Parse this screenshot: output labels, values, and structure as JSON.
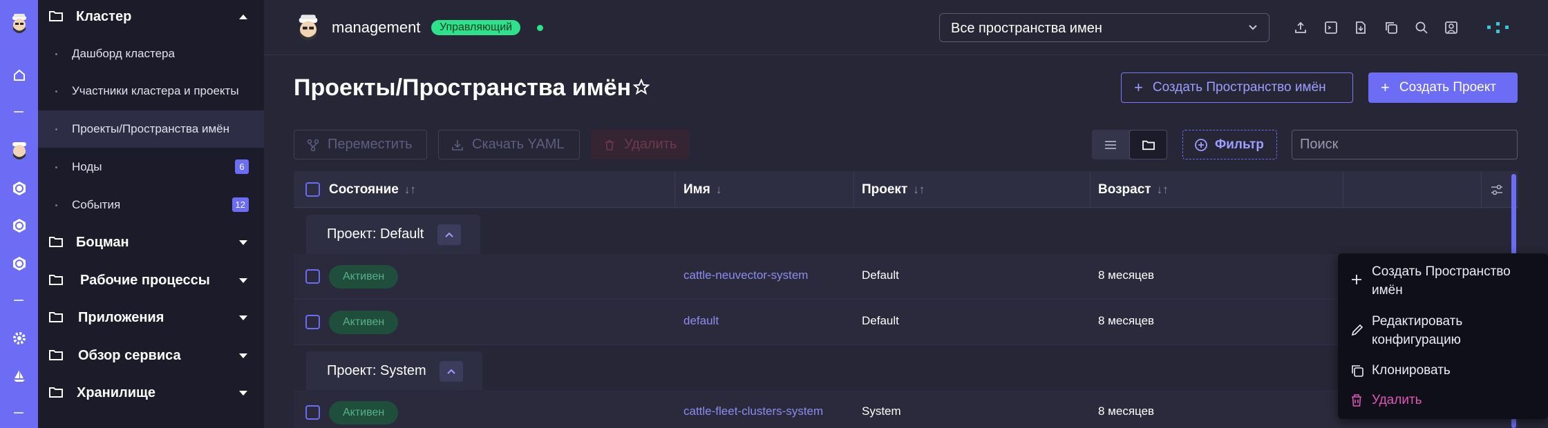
{
  "rail": {
    "items": [
      "ship-logo",
      "home-icon",
      "divider",
      "cluster-logo",
      "kubernetes-icon",
      "kubernetes-icon",
      "kubernetes-icon",
      "divider",
      "gear-icon",
      "sailboat-icon",
      "divider"
    ]
  },
  "sidebar": {
    "cluster_group": "Кластер",
    "cluster_items": [
      {
        "label": "Дашборд кластера"
      },
      {
        "label": "Участники кластера и проекты"
      },
      {
        "label": "Проекты/Пространства имён",
        "active": true
      },
      {
        "label": "Ноды",
        "count": "6"
      },
      {
        "label": "События",
        "count": "12"
      }
    ],
    "groups": [
      "Боцман",
      "Рабочие процессы",
      "Приложения",
      "Обзор сервиса",
      "Хранилище"
    ]
  },
  "header": {
    "cluster_name": "management",
    "badge": "Управляющий",
    "namespace_select": "Все пространства имен",
    "icons": [
      "upload-icon",
      "terminal-icon",
      "download-file-icon",
      "copy-icon",
      "search-icon",
      "user-icon",
      "more-dots-icon"
    ]
  },
  "page": {
    "title": "Проекты/Пространства имён",
    "create_namespace": "Создать Пространство имён",
    "create_project": "Создать Проект"
  },
  "toolbar": {
    "move": "Переместить",
    "download_yaml": "Скачать YAML",
    "delete": "Удалить",
    "filter": "Фильтр",
    "search_placeholder": "Поиск"
  },
  "table": {
    "columns": {
      "state": "Состояние",
      "name": "Имя",
      "project": "Проект",
      "age": "Возраст"
    },
    "groups": [
      {
        "label": "Проект: Default",
        "rows": [
          {
            "state": "Активен",
            "name": "cattle-neuvector-system",
            "project": "Default",
            "age": "8 месяцев"
          },
          {
            "state": "Активен",
            "name": "default",
            "project": "Default",
            "age": "8 месяцев"
          }
        ]
      },
      {
        "label": "Проект: System",
        "rows": [
          {
            "state": "Активен",
            "name": "cattle-fleet-clusters-system",
            "project": "System",
            "age": "8 месяцев"
          }
        ]
      }
    ]
  },
  "context_menu": {
    "create_namespace": "Создать Пространство имён",
    "edit_config": "Редактировать конфигурацию",
    "clone": "Клонировать",
    "delete": "Удалить"
  },
  "colors": {
    "accent": "#6c6cf5",
    "active_badge": "#2de28a",
    "danger": "#e056b5",
    "sidebar_bg": "#1b1b29"
  }
}
